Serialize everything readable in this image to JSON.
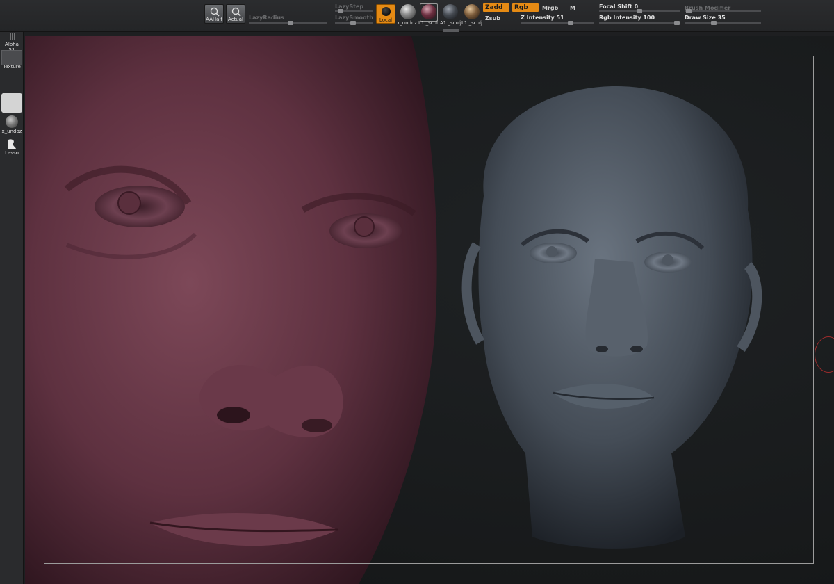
{
  "toolbar": {
    "aahalf_label": "AAHalf",
    "actual_label": "Actual",
    "lazy_radius_label": "LazyRadius",
    "lazy_step_label": "LazyStep",
    "lazy_smooth_label": "LazySmooth",
    "local_label": "Local",
    "materials": [
      {
        "label": "x_undoz"
      },
      {
        "label": "L1 _scul"
      },
      {
        "label": "A1 _sculj"
      },
      {
        "label": "L1 _sculj"
      }
    ],
    "zadd_label": "Zadd",
    "zsub_label": "Zsub",
    "rgb_label": "Rgb",
    "mrgb_label": "Mrgb",
    "m_label": "M",
    "z_intensity_label": "Z Intensity 51",
    "rgb_intensity_label": "Rgb Intensity 100",
    "focal_shift_label": "Focal Shift 0",
    "draw_size_label": "Draw Size 35",
    "brush_modifier_label": "Brush Modifier"
  },
  "shelf": {
    "alpha_label": "Alpha 51",
    "texture_label": "Texture",
    "brush_label": "x_undoz",
    "stroke_label": "Lasso"
  },
  "colors": {
    "accent": "#e58a14",
    "skin_close": "#6b3b49",
    "skin_head": "#525b66"
  },
  "icons": {
    "aahalf": "magnify-half-icon",
    "actual": "magnify-actual-icon",
    "local": "local-globe-icon",
    "lasso": "lasso-icon"
  }
}
